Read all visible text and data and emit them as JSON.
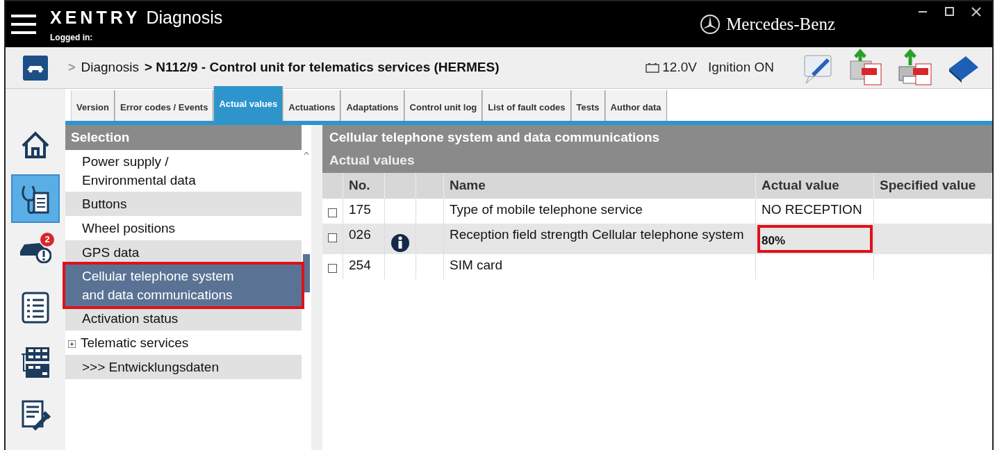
{
  "app": {
    "brand": "XENTRY",
    "title": "Diagnosis",
    "logged_in": "Logged in:",
    "maker": "Mercedes-Benz"
  },
  "breadcrumb": {
    "separator": ">",
    "link": "Diagnosis",
    "current": "> N112/9 - Control unit for telematics services (HERMES)"
  },
  "status": {
    "voltage": "12.0V",
    "ignition": "Ignition ON"
  },
  "nav_rail": [
    {
      "kind": "home",
      "selected": false
    },
    {
      "kind": "diagnosis",
      "selected": true
    },
    {
      "kind": "vehicle",
      "selected": false,
      "badge": "2"
    },
    {
      "kind": "list",
      "selected": false
    },
    {
      "kind": "modules",
      "selected": false
    },
    {
      "kind": "tools",
      "selected": false
    }
  ],
  "tabs": [
    {
      "label": "Version",
      "selected": false
    },
    {
      "label": "Error codes / Events",
      "selected": false
    },
    {
      "label": "Actual values",
      "selected": true
    },
    {
      "label": "Actuations",
      "selected": false
    },
    {
      "label": "Adaptations",
      "selected": false
    },
    {
      "label": "Control unit log",
      "selected": false
    },
    {
      "label": "List of fault codes",
      "selected": false
    },
    {
      "label": "Tests",
      "selected": false
    },
    {
      "label": "Author data",
      "selected": false
    }
  ],
  "selection": {
    "title": "Selection",
    "items": [
      {
        "label": "Power supply / Environmental data",
        "selected": false,
        "highlighted": false,
        "expandable": false
      },
      {
        "label": "Buttons",
        "selected": false,
        "highlighted": false,
        "expandable": false
      },
      {
        "label": "Wheel positions",
        "selected": false,
        "highlighted": false,
        "expandable": false
      },
      {
        "label": "GPS data",
        "selected": false,
        "highlighted": false,
        "expandable": false
      },
      {
        "label": "Cellular telephone system and data communications",
        "selected": true,
        "highlighted": true,
        "expandable": false
      },
      {
        "label": "Activation status",
        "selected": false,
        "highlighted": false,
        "expandable": false
      },
      {
        "label": "Telematic services",
        "selected": false,
        "highlighted": false,
        "expandable": true
      },
      {
        "label": ">>> Entwicklungsdaten",
        "selected": false,
        "highlighted": false,
        "expandable": false
      }
    ]
  },
  "actual_values": {
    "section": "Cellular telephone system and data communications",
    "title": "Actual values",
    "columns": [
      "No.",
      "Name",
      "Actual value",
      "Specified value"
    ],
    "rows": [
      {
        "checked": false,
        "no": "175",
        "info": false,
        "name": "Type of mobile telephone service",
        "actual": "NO RECEPTION",
        "highlighted": false
      },
      {
        "checked": false,
        "no": "026",
        "info": true,
        "name": "Reception field strength Cellular telephone system",
        "actual": "80%",
        "highlighted": true
      },
      {
        "checked": false,
        "no": "254",
        "info": false,
        "name": "SIM card",
        "actual": "",
        "highlighted": false
      }
    ]
  }
}
